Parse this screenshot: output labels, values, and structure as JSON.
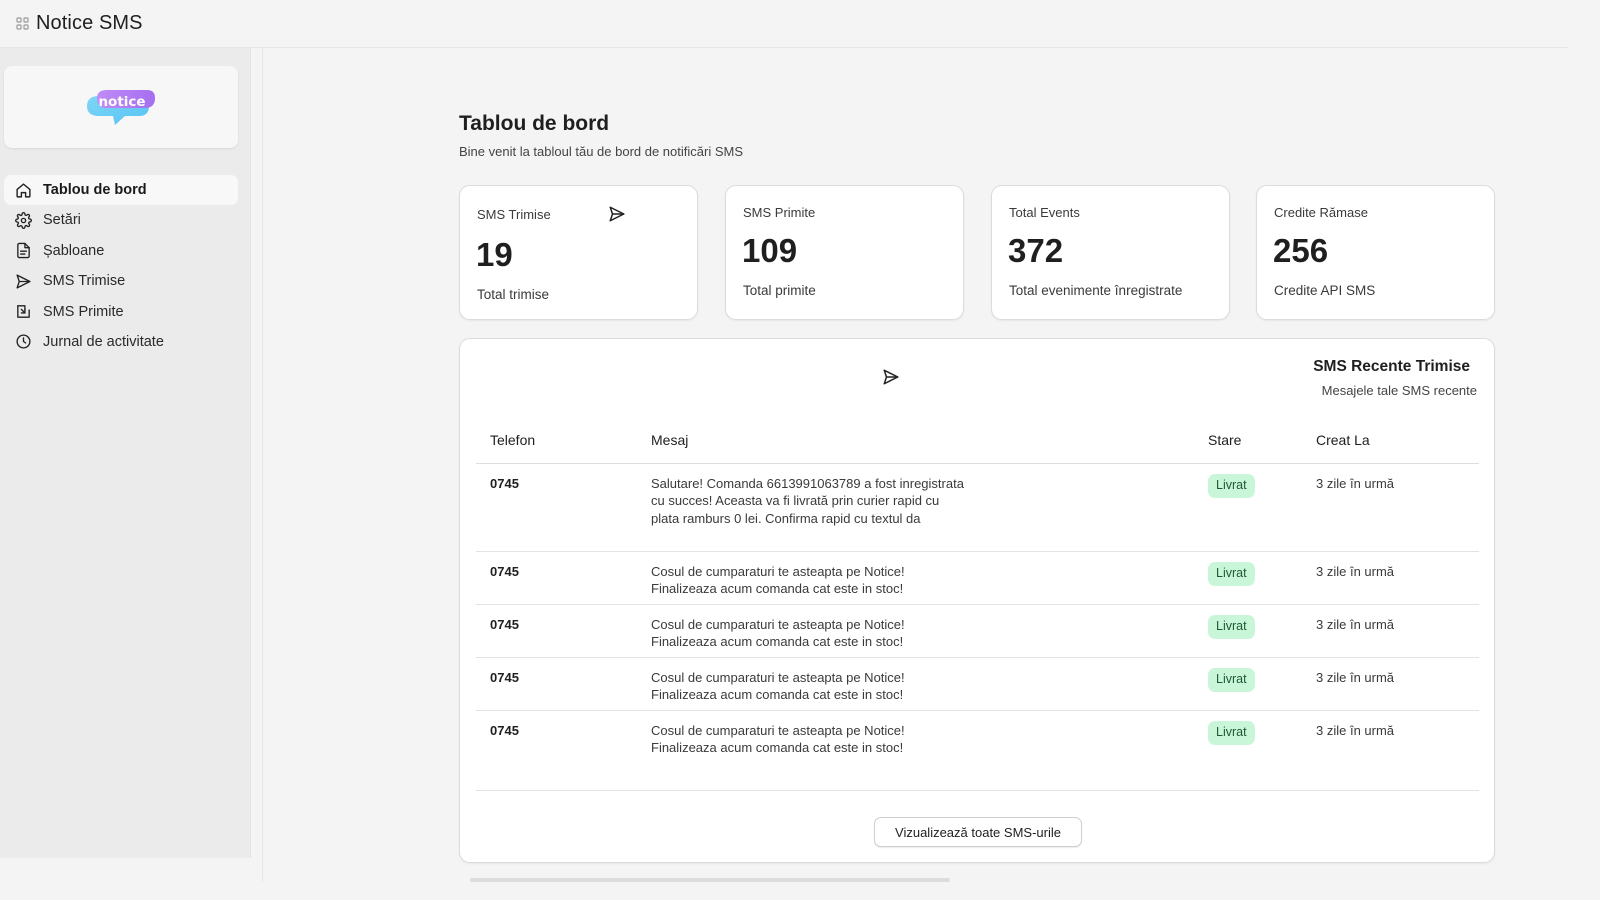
{
  "app": {
    "title": "Notice SMS",
    "icon": "app-grid-icon"
  },
  "logo": {
    "text": "notice"
  },
  "sidebar": {
    "items": [
      {
        "label": "Tablou de bord",
        "icon": "home-icon",
        "active": true
      },
      {
        "label": "Setări",
        "icon": "gear-icon",
        "active": false
      },
      {
        "label": "Șabloane",
        "icon": "document-icon",
        "active": false
      },
      {
        "label": "SMS Trimise",
        "icon": "send-icon",
        "active": false
      },
      {
        "label": "SMS Primite",
        "icon": "inbox-icon",
        "active": false
      },
      {
        "label": "Jurnal de activitate",
        "icon": "clock-icon",
        "active": false
      }
    ]
  },
  "page": {
    "title": "Tablou de bord",
    "subtitle": "Bine venit la tabloul tău de bord de notificări SMS"
  },
  "stats": [
    {
      "label": "SMS Trimise",
      "value": "19",
      "caption": "Total trimise",
      "icon": "send-icon"
    },
    {
      "label": "SMS Primite",
      "value": "109",
      "caption": "Total primite"
    },
    {
      "label": "Total Events",
      "value": "372",
      "caption": "Total evenimente înregistrate"
    },
    {
      "label": "Credite Rămase",
      "value": "256",
      "caption": "Credite API SMS"
    }
  ],
  "recent": {
    "title": "SMS Recente Trimise",
    "subtitle": "Mesajele tale SMS recente",
    "icon": "send-icon",
    "columns": {
      "phone": "Telefon",
      "message": "Mesaj",
      "status": "Stare",
      "created": "Creat La"
    },
    "rows": [
      {
        "phone": "0745",
        "message": "Salutare! Comanda 6613991063789 a fost inregistrata cu succes! Aceasta va fi livrată prin curier rapid cu plata ramburs 0 lei. Confirma rapid cu textul da",
        "status": "Livrat",
        "created": "3 zile în urmă"
      },
      {
        "phone": "0745",
        "message": "Cosul de cumparaturi te asteapta pe Notice! Finalizeaza acum comanda cat este in stoc!",
        "status": "Livrat",
        "created": "3 zile în urmă"
      },
      {
        "phone": "0745",
        "message": "Cosul de cumparaturi te asteapta pe Notice! Finalizeaza acum comanda cat este in stoc!",
        "status": "Livrat",
        "created": "3 zile în urmă"
      },
      {
        "phone": "0745",
        "message": "Cosul de cumparaturi te asteapta pe Notice! Finalizeaza acum comanda cat este in stoc!",
        "status": "Livrat",
        "created": "3 zile în urmă"
      },
      {
        "phone": "0745",
        "message": "Cosul de cumparaturi te asteapta pe Notice! Finalizeaza acum comanda cat este in stoc!",
        "status": "Livrat",
        "created": "3 zile în urmă"
      }
    ],
    "view_all_label": "Vizualizează toate SMS-urile"
  },
  "colors": {
    "badge_bg": "#c9f6d8",
    "badge_text": "#1e5a33",
    "logo_purple": "#b07cf3",
    "logo_blue": "#7fd6f7"
  }
}
